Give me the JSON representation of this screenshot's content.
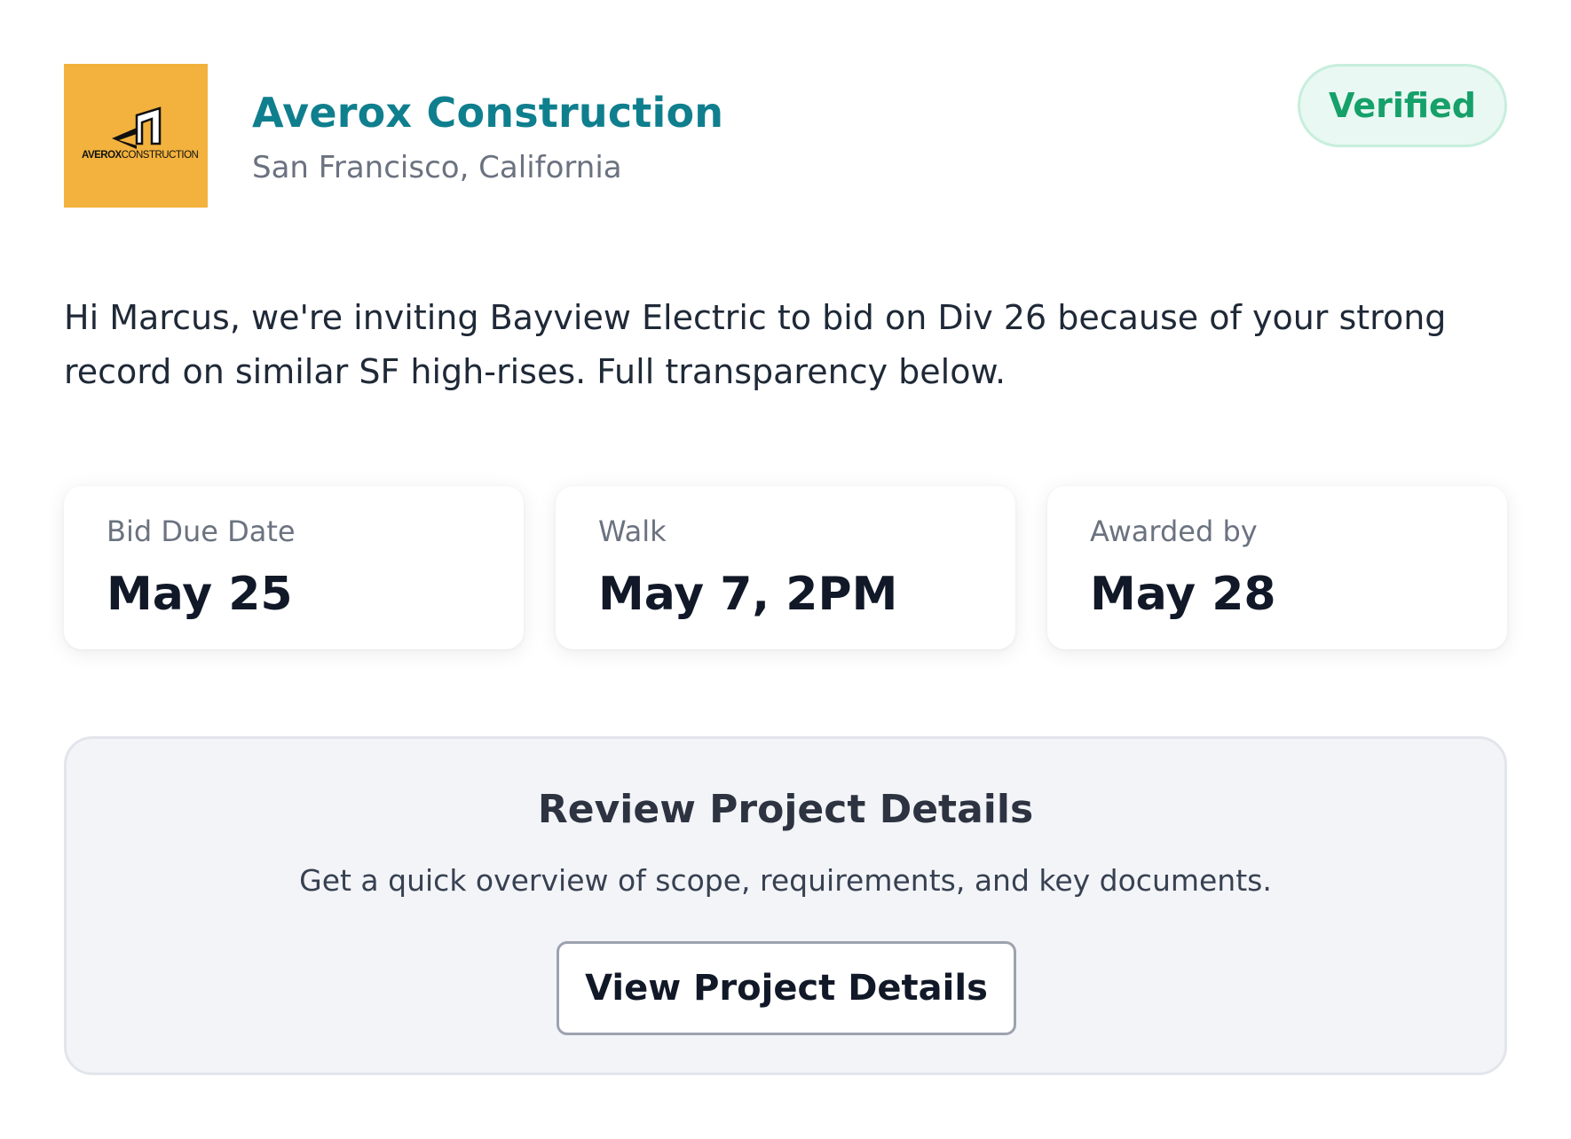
{
  "company": {
    "name": "Averox Construction",
    "location": "San Francisco, California",
    "logo": {
      "text_bold": "AVEROX",
      "text_light": "CONSTRUCTION",
      "background_color": "#f2b23d"
    },
    "badge_label": "Verified"
  },
  "message": "Hi Marcus, we're inviting Bayview Electric to bid on Div 26 because of your strong record on similar SF high-rises. Full transparency below.",
  "stats": [
    {
      "label": "Bid Due Date",
      "value": "May 25"
    },
    {
      "label": "Walk",
      "value": "May 7, 2PM"
    },
    {
      "label": "Awarded by",
      "value": "May 28"
    }
  ],
  "review": {
    "title": "Review Project Details",
    "subtitle": "Get a quick overview of scope, requirements, and key documents.",
    "button_label": "View Project Details"
  },
  "colors": {
    "brand_teal": "#0f7f8e",
    "verified_green": "#16a06a"
  }
}
